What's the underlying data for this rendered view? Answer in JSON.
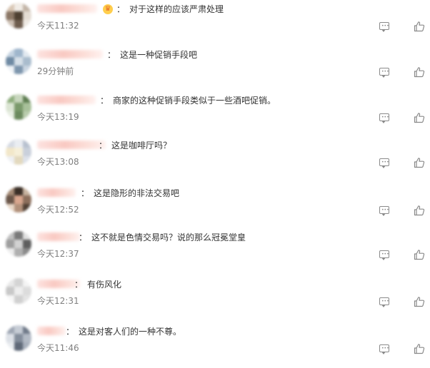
{
  "comments": [
    {
      "text": "对于这样的应该严肃处理",
      "time": "今天11:32",
      "has_badge": true,
      "badge_icon": "crown-icon",
      "avatar_colors": [
        "#d9c7b5",
        "#f1ece6",
        "#c3b5a7",
        "#8b7766",
        "#4e4032",
        "#e4dcd3",
        "#cbbfb3",
        "#6e5d4e",
        "#ede8e2"
      ]
    },
    {
      "text": "这是一种促销手段吧",
      "time": "29分钟前",
      "has_badge": false,
      "avatar_colors": [
        "#c6d4e2",
        "#9fb6cc",
        "#e2e9f0",
        "#6f8aa3",
        "#d7e0e8",
        "#a9bccd",
        "#eef2f6",
        "#7e96ad",
        "#c9d5e1"
      ]
    },
    {
      "text": "商家的这种促销手段类似于一些酒吧促销。",
      "time": "今天13:19",
      "has_badge": false,
      "avatar_colors": [
        "#8fae7e",
        "#c7d6bd",
        "#5f7e52",
        "#dbe5d3",
        "#7a9a6b",
        "#a8c09a",
        "#e7eee2",
        "#6b8a5e",
        "#b9ccad"
      ]
    },
    {
      "text": "这是咖啡厅吗？",
      "time": "今天13:08",
      "has_badge": false,
      "avatar_colors": [
        "#d6dbe4",
        "#eaedf2",
        "#b8c1cf",
        "#f2e7c9",
        "#f6efd9",
        "#c9d0db",
        "#eef0f3",
        "#e3d9be",
        "#dde2ea"
      ]
    },
    {
      "text": "这是隐形的非法交易吧",
      "time": "今天12:52",
      "has_badge": false,
      "avatar_colors": [
        "#a58b76",
        "#3a2f27",
        "#c7b3a0",
        "#6b574a",
        "#d9a68e",
        "#8c6f5c",
        "#e8d8c8",
        "#b2917b",
        "#4f3f33"
      ]
    },
    {
      "text": "这不就是色情交易吗？说的那么冠冕堂皇",
      "time": "今天12:37",
      "has_badge": false,
      "avatar_colors": [
        "#bfbfbf",
        "#7a7a7a",
        "#e0e0e0",
        "#9e9e9e",
        "#d2d2d2",
        "#5e5e5e",
        "#ececec",
        "#b0b0b0",
        "#8a8a8a"
      ]
    },
    {
      "text": "有伤风化",
      "time": "今天12:31",
      "has_badge": false,
      "avatar_colors": [
        "#e9e9e9",
        "#d4d4d4",
        "#f4f4f4",
        "#c8c8c8",
        "#eeeeee",
        "#dcdcdc",
        "#f7f7f7",
        "#d0d0d0",
        "#e4e4e4"
      ]
    },
    {
      "text": "这是对客人们的一种不尊。",
      "time": "今天11:46",
      "has_badge": false,
      "avatar_colors": [
        "#9ea6b3",
        "#c6ccd5",
        "#707a89",
        "#dde1e7",
        "#848e9c",
        "#b3bac5",
        "#e9ecf0",
        "#5f6978",
        "#a9b1bd"
      ]
    }
  ],
  "actions": {
    "reply_icon": "comment-icon",
    "like_icon": "thumbs-up-icon"
  },
  "colors": {
    "text": "#333333",
    "time": "#808080",
    "icon": "#8a8a8a",
    "name_blur": "#f9c9c2"
  }
}
